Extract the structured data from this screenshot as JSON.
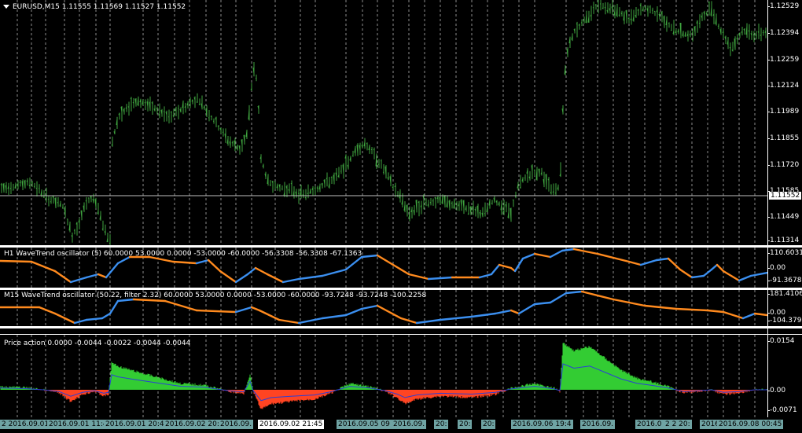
{
  "main": {
    "title": "EURUSD,M15  1.11555 1.11569 1.11527 1.11552",
    "price_scale": [
      "1.12529",
      "1.12394",
      "1.12259",
      "1.12124",
      "1.11989",
      "1.11855",
      "1.11720",
      "1.11585",
      "1.11449",
      "1.11314"
    ],
    "current_price": "1.11552",
    "colors": {
      "candles": "#3fa33f",
      "price_line": "#c0c0c0",
      "grid": "#ffffff"
    }
  },
  "indicator_h1": {
    "title": "H1 WaveTrend oscillator (5) 60.0000 53.0000 0.0000 -53.0000 -60.0000 -56.3308 -56.3308 -67.1363",
    "scale": [
      "110.6031",
      "0.00",
      "-91.3678"
    ],
    "colors": {
      "up": "#3b8ff0",
      "down": "#ff8a1e"
    }
  },
  "indicator_m15": {
    "title": "M15 WaveTrend oscillator (50.22, filter 2.32) 60.0000 53.0000 0.0000 -53.0000 -60.0000 -93.7248 -93.7248 -100.2258",
    "scale": [
      "181.4106",
      "0.00",
      "-104.3799"
    ],
    "colors": {
      "up": "#3b8ff0",
      "down": "#ff8a1e"
    }
  },
  "price_action": {
    "title": "Price action 0.0000 -0.0044 -0.0022 -0.0044 -0.0044",
    "scale": [
      "0.0154",
      "0.00",
      "-0.0071"
    ],
    "colors": {
      "positive": "#33cc33",
      "negative": "#ff4422",
      "line": "#2b3fd6"
    }
  },
  "time_axis": [
    "2 2016.09.01",
    "2016.09.01 11:4",
    "2016.09.01 20:4",
    "2016.09.02 20:",
    "2016.09.",
    "2016.09.02 21:45",
    "2016.09.05 09",
    "2016.09.",
    "20:",
    "20:",
    "20:",
    "2016.09.06 19:4",
    "2016.09.",
    "2016.0",
    "2 2 20:",
    "2016",
    "2016.09.08 00:45"
  ]
}
